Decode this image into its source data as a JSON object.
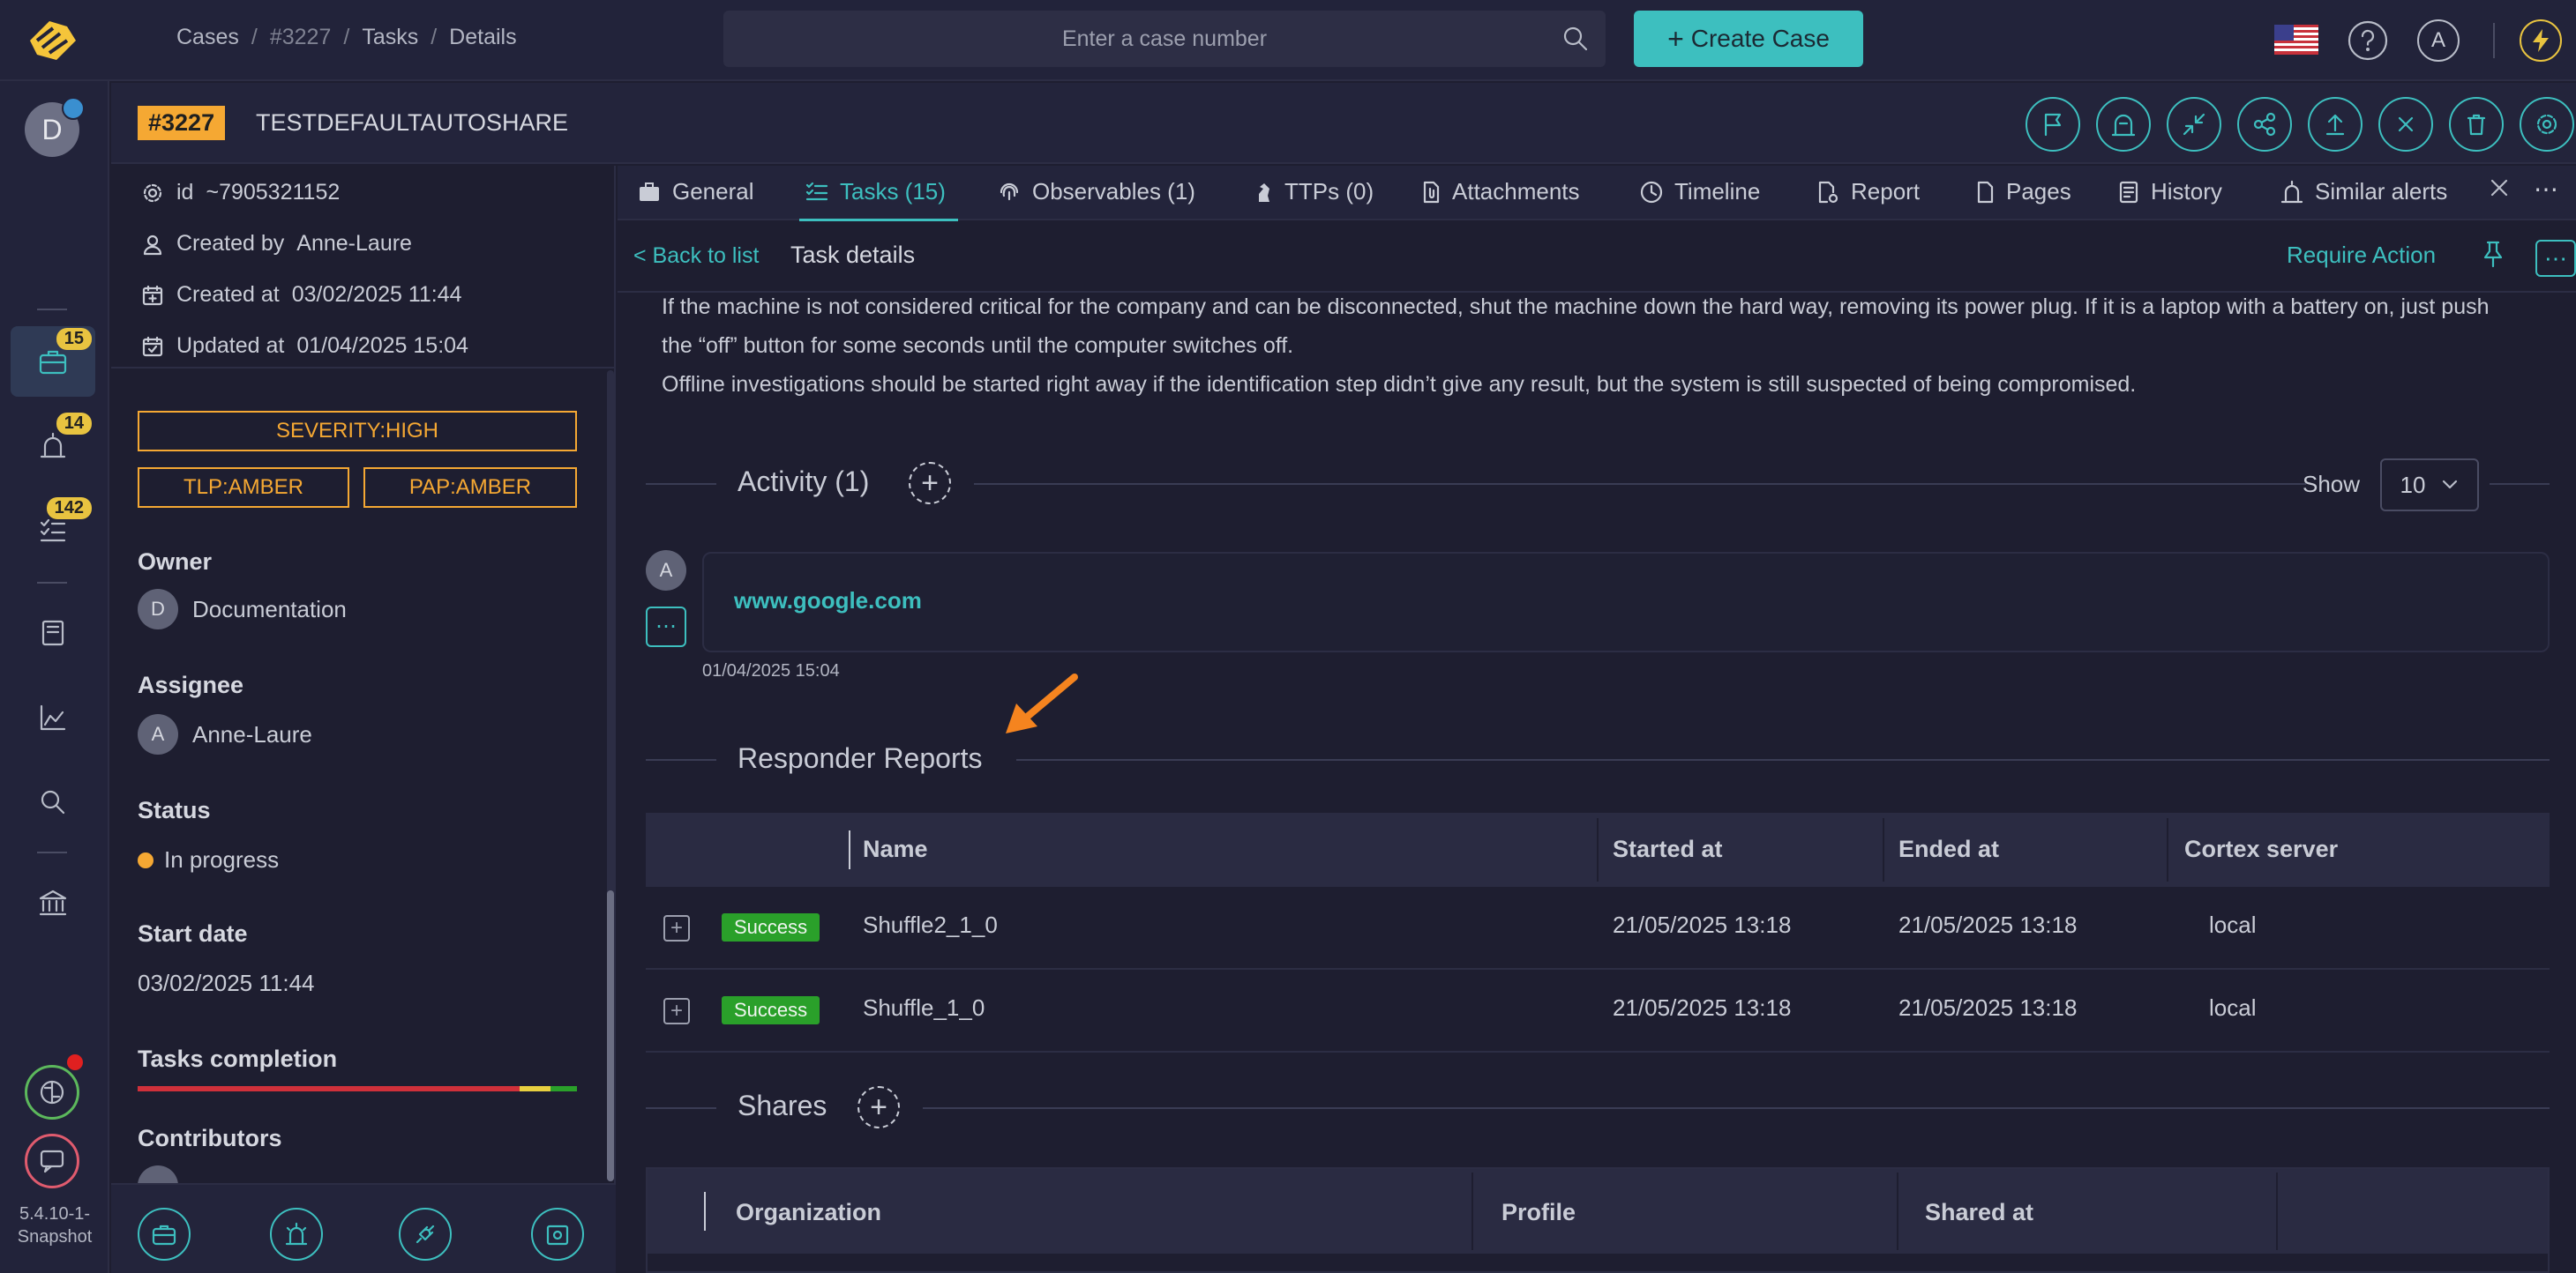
{
  "breadcrumb": [
    "Cases",
    "#3227",
    "Tasks",
    "Details"
  ],
  "search": {
    "placeholder": "Enter a case number"
  },
  "create_case_label": "Create Case",
  "user_initial": "A",
  "nav": {
    "user_initial": "D",
    "badges": {
      "cases": "15",
      "alerts": "14",
      "tasks": "142"
    },
    "version": "5.4.10-1-Snapshot"
  },
  "case": {
    "number": "#3227",
    "title": "TESTDEFAULTAUTOSHARE"
  },
  "details": {
    "id": "~7905321152",
    "created_by_label": "Created by",
    "created_by": "Anne-Laure",
    "created_at_label": "Created at",
    "created_at": "03/02/2025 11:44",
    "updated_at_label": "Updated at",
    "updated_at": "01/04/2025 15:04",
    "tags": {
      "severity": "SEVERITY:HIGH",
      "tlp": "TLP:AMBER",
      "pap": "PAP:AMBER"
    },
    "owner_label": "Owner",
    "owner": {
      "initial": "D",
      "name": "Documentation"
    },
    "assignee_label": "Assignee",
    "assignee": {
      "initial": "A",
      "name": "Anne-Laure"
    },
    "status_label": "Status",
    "status": "In progress",
    "start_date_label": "Start date",
    "start_date": "03/02/2025 11:44",
    "completion_label": "Tasks completion",
    "completion": {
      "red": 0.87,
      "yellow": 0.07,
      "green": 0.06
    },
    "contributors_label": "Contributors"
  },
  "tabs": {
    "general": "General",
    "tasks": "Tasks (15)",
    "observables": "Observables (1)",
    "ttps": "TTPs (0)",
    "attachments": "Attachments",
    "timeline": "Timeline",
    "report": "Report",
    "pages": "Pages",
    "history": "History",
    "similar": "Similar alerts"
  },
  "task": {
    "back_label": "< Back to list",
    "title": "Task details",
    "require_action": "Require Action",
    "description": [
      "If the machine is not considered critical for the company and can be disconnected, shut the machine down the hard way, removing its power plug. If it is a laptop with a battery on, just push the “off” button for some seconds until the computer switches off.",
      "Offline investigations should be started right away if the identification step didn’t give any result, but the system is still suspected of being compromised."
    ]
  },
  "activity": {
    "title": "Activity (1)",
    "show_label": "Show",
    "show_value": "10",
    "entry": {
      "author_initial": "A",
      "link": "www.google.com",
      "time": "01/04/2025 15:04"
    }
  },
  "responders": {
    "title": "Responder Reports",
    "columns": [
      "Name",
      "Started at",
      "Ended at",
      "Cortex server"
    ],
    "rows": [
      {
        "status": "Success",
        "name": "Shuffle2_1_0",
        "started": "21/05/2025 13:18",
        "ended": "21/05/2025 13:18",
        "server": "local"
      },
      {
        "status": "Success",
        "name": "Shuffle_1_0",
        "started": "21/05/2025 13:18",
        "ended": "21/05/2025 13:18",
        "server": "local"
      }
    ]
  },
  "shares": {
    "title": "Shares",
    "columns": [
      "Organization",
      "Profile",
      "Shared at"
    ]
  },
  "colors": {
    "accent": "#3dbfbf",
    "amber": "#f5a833",
    "success": "#2aa02a",
    "badge": "#e8c340"
  }
}
